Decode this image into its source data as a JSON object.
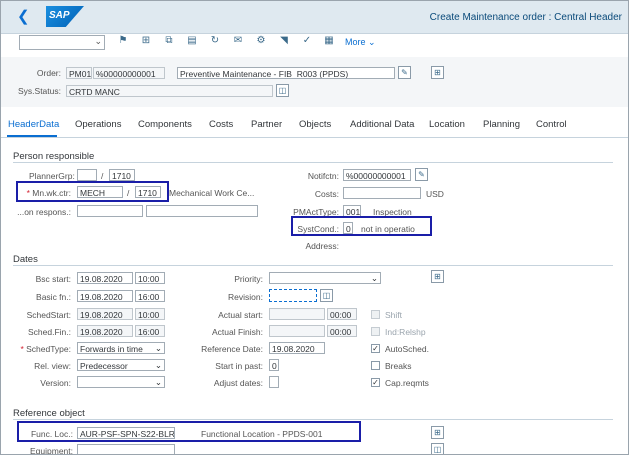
{
  "shell": {
    "title": "Create Maintenance order : Central Header",
    "logo": "SAP"
  },
  "toolbar": {
    "more_label": "More",
    "select_value": ""
  },
  "header": {
    "order_label": "Order:",
    "order_type": "PM01",
    "order_number": "%00000000001",
    "order_desc": "Preventive Maintenance - FIB_R003 (PPDS)",
    "sysstatus_label": "Sys.Status:",
    "sysstatus_value": "CRTD MANC"
  },
  "tabs": [
    "HeaderData",
    "Operations",
    "Components",
    "Costs",
    "Partner",
    "Objects",
    "Additional Data",
    "Location",
    "Planning",
    "Control"
  ],
  "person": {
    "title": "Person responsible",
    "plannergrp_label": "PlannerGrp:",
    "plannergrp_value": "",
    "plannergrp_plant": "1710",
    "mnwkctr_label": "Mn.wk.ctr:",
    "mnwkctr_value": "MECH",
    "mnwkctr_plant": "1710",
    "mnwkctr_desc": "Mechanical Work Ce...",
    "onrespons_label": "...on respons.:",
    "notifctn_label": "Notifctn:",
    "notifctn_value": "%00000000001",
    "costs_label": "Costs:",
    "costs_currency": "USD",
    "pmacttype_label": "PMActType:",
    "pmacttype_value": "001",
    "pmacttype_desc": "Inspection",
    "systcond_label": "SystCond.:",
    "systcond_value": "0",
    "systcond_desc": "not in operatio",
    "address_label": "Address:"
  },
  "dates": {
    "title": "Dates",
    "bsc_start_label": "Bsc start:",
    "bsc_start_date": "19.08.2020",
    "bsc_start_time": "10:00",
    "basic_fin_label": "Basic fn.:",
    "basic_fin_date": "19.08.2020",
    "basic_fin_time": "16:00",
    "schedstart_label": "SchedStart:",
    "schedstart_date": "19.08.2020",
    "schedstart_time": "10:00",
    "schedfin_label": "Sched.Fin.:",
    "schedfin_date": "19.08.2020",
    "schedfin_time": "16:00",
    "schedtype_label": "SchedType:",
    "schedtype_value": "Forwards in time",
    "relview_label": "Rel. view:",
    "relview_value": "Predecessor",
    "version_label": "Version:",
    "version_value": "",
    "priority_label": "Priority:",
    "priority_value": "",
    "revision_label": "Revision:",
    "revision_value": "",
    "actual_start_label": "Actual start:",
    "actual_start_time": "00:00",
    "actual_finish_label": "Actual Finish:",
    "actual_finish_time": "00:00",
    "reference_date_label": "Reference Date:",
    "reference_date_value": "19.08.2020",
    "start_in_past_label": "Start in past:",
    "start_in_past_value": "0",
    "adjust_dates_label": "Adjust dates:",
    "shift_label": "Shift",
    "indrelshp_label": "Ind:Relshp",
    "autosched_label": "AutoSched.",
    "breaks_label": "Breaks",
    "capreqmts_label": "Cap.reqmts"
  },
  "refobj": {
    "title": "Reference object",
    "funcloc_label": "Func. Loc.:",
    "funcloc_value": "AUR-PSF-SPN-S22-BLR...",
    "funcloc_desc": "Functional Location - PPDS-001",
    "equipment_label": "Equipment:"
  },
  "colors": {
    "highlight": "#1a1ea8",
    "accent": "#0a6ed1",
    "shell_bg": "#dfe9f0"
  }
}
